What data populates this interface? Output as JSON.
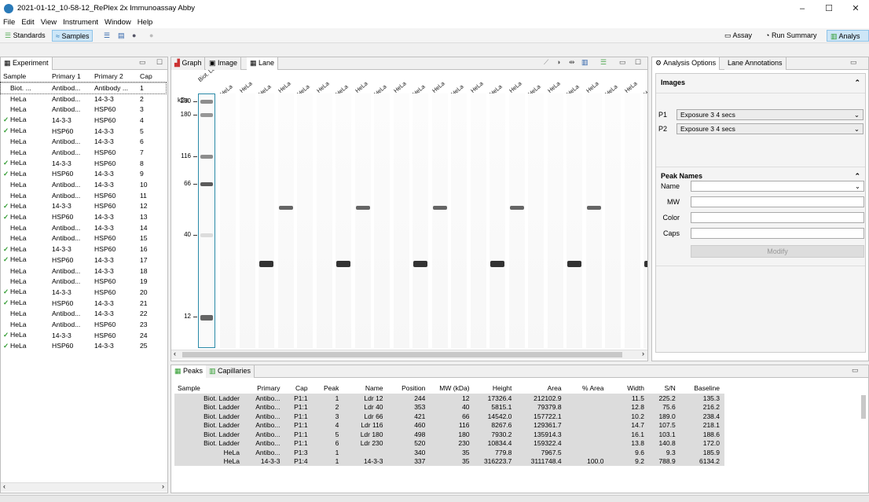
{
  "window": {
    "title": "2021-01-12_10-58-12_RePlex 2x Immunoassay Abby",
    "minimize": "–",
    "maximize": "☐",
    "close": "✕"
  },
  "menu": [
    "File",
    "Edit",
    "View",
    "Instrument",
    "Window",
    "Help"
  ],
  "toolbar": {
    "standards": "Standards",
    "samples": "Samples",
    "assay": "Assay",
    "run_summary": "Run Summary",
    "analysis": "Analys"
  },
  "experiment": {
    "tab": "Experiment",
    "headers": [
      "Sample",
      "Primary 1",
      "Primary 2",
      "Cap"
    ],
    "rows": [
      {
        "check": "",
        "sample": "Biot. ...",
        "p1": "Antibod...",
        "p2": "Antibody ...",
        "cap": "1"
      },
      {
        "check": "",
        "sample": "HeLa",
        "p1": "Antibod...",
        "p2": "14-3-3",
        "cap": "2"
      },
      {
        "check": "",
        "sample": "HeLa",
        "p1": "Antibod...",
        "p2": "HSP60",
        "cap": "3"
      },
      {
        "check": "✓",
        "sample": "HeLa",
        "p1": "14-3-3",
        "p2": "HSP60",
        "cap": "4"
      },
      {
        "check": "✓",
        "sample": "HeLa",
        "p1": "HSP60",
        "p2": "14-3-3",
        "cap": "5"
      },
      {
        "check": "",
        "sample": "HeLa",
        "p1": "Antibod...",
        "p2": "14-3-3",
        "cap": "6"
      },
      {
        "check": "",
        "sample": "HeLa",
        "p1": "Antibod...",
        "p2": "HSP60",
        "cap": "7"
      },
      {
        "check": "✓",
        "sample": "HeLa",
        "p1": "14-3-3",
        "p2": "HSP60",
        "cap": "8"
      },
      {
        "check": "✓",
        "sample": "HeLa",
        "p1": "HSP60",
        "p2": "14-3-3",
        "cap": "9"
      },
      {
        "check": "",
        "sample": "HeLa",
        "p1": "Antibod...",
        "p2": "14-3-3",
        "cap": "10"
      },
      {
        "check": "",
        "sample": "HeLa",
        "p1": "Antibod...",
        "p2": "HSP60",
        "cap": "11"
      },
      {
        "check": "✓",
        "sample": "HeLa",
        "p1": "14-3-3",
        "p2": "HSP60",
        "cap": "12"
      },
      {
        "check": "✓",
        "sample": "HeLa",
        "p1": "HSP60",
        "p2": "14-3-3",
        "cap": "13"
      },
      {
        "check": "",
        "sample": "HeLa",
        "p1": "Antibod...",
        "p2": "14-3-3",
        "cap": "14"
      },
      {
        "check": "",
        "sample": "HeLa",
        "p1": "Antibod...",
        "p2": "HSP60",
        "cap": "15"
      },
      {
        "check": "✓",
        "sample": "HeLa",
        "p1": "14-3-3",
        "p2": "HSP60",
        "cap": "16"
      },
      {
        "check": "✓",
        "sample": "HeLa",
        "p1": "HSP60",
        "p2": "14-3-3",
        "cap": "17"
      },
      {
        "check": "",
        "sample": "HeLa",
        "p1": "Antibod...",
        "p2": "14-3-3",
        "cap": "18"
      },
      {
        "check": "",
        "sample": "HeLa",
        "p1": "Antibod...",
        "p2": "HSP60",
        "cap": "19"
      },
      {
        "check": "✓",
        "sample": "HeLa",
        "p1": "14-3-3",
        "p2": "HSP60",
        "cap": "20"
      },
      {
        "check": "✓",
        "sample": "HeLa",
        "p1": "HSP60",
        "p2": "14-3-3",
        "cap": "21"
      },
      {
        "check": "",
        "sample": "HeLa",
        "p1": "Antibod...",
        "p2": "14-3-3",
        "cap": "22"
      },
      {
        "check": "",
        "sample": "HeLa",
        "p1": "Antibod...",
        "p2": "HSP60",
        "cap": "23"
      },
      {
        "check": "✓",
        "sample": "HeLa",
        "p1": "14-3-3",
        "p2": "HSP60",
        "cap": "24"
      },
      {
        "check": "✓",
        "sample": "HeLa",
        "p1": "HSP60",
        "p2": "14-3-3",
        "cap": "25"
      }
    ]
  },
  "lane_view": {
    "tabs": [
      "Graph",
      "Image",
      "Lane"
    ],
    "kda": "kDa",
    "ladder_label": "Biot. Ladder",
    "sample_label": "HeLa",
    "mw_ticks": [
      "230",
      "180",
      "116",
      "66",
      "40",
      "12"
    ]
  },
  "bottom": {
    "tabs": [
      "Peaks",
      "Capillaries"
    ],
    "headers": [
      "Sample",
      "Primary",
      "Cap",
      "Peak",
      "Name",
      "Position",
      "MW (kDa)",
      "Height",
      "Area",
      "% Area",
      "Width",
      "S/N",
      "Baseline"
    ],
    "rows": [
      [
        "Biot. Ladder",
        "Antibo...",
        "P1:1",
        "1",
        "Ldr 12",
        "244",
        "12",
        "17326.4",
        "212102.9",
        "",
        "11.5",
        "225.2",
        "135.3"
      ],
      [
        "Biot. Ladder",
        "Antibo...",
        "P1:1",
        "2",
        "Ldr 40",
        "353",
        "40",
        "5815.1",
        "79379.8",
        "",
        "12.8",
        "75.6",
        "216.2"
      ],
      [
        "Biot. Ladder",
        "Antibo...",
        "P1:1",
        "3",
        "Ldr 66",
        "421",
        "66",
        "14542.0",
        "157722.1",
        "",
        "10.2",
        "189.0",
        "238.4"
      ],
      [
        "Biot. Ladder",
        "Antibo...",
        "P1:1",
        "4",
        "Ldr 116",
        "460",
        "116",
        "8267.6",
        "129361.7",
        "",
        "14.7",
        "107.5",
        "218.1"
      ],
      [
        "Biot. Ladder",
        "Antibo...",
        "P1:1",
        "5",
        "Ldr 180",
        "498",
        "180",
        "7930.2",
        "135914.3",
        "",
        "16.1",
        "103.1",
        "188.6"
      ],
      [
        "Biot. Ladder",
        "Antibo...",
        "P1:1",
        "6",
        "Ldr 230",
        "520",
        "230",
        "10834.4",
        "159322.4",
        "",
        "13.8",
        "140.8",
        "172.0"
      ],
      [
        "HeLa",
        "Antibo...",
        "P1:3",
        "1",
        "",
        "340",
        "35",
        "779.8",
        "7967.5",
        "",
        "9.6",
        "9.3",
        "185.9"
      ],
      [
        "HeLa",
        "14-3-3",
        "P1:4",
        "1",
        "14-3-3",
        "337",
        "35",
        "316223.7",
        "3111748.4",
        "100.0",
        "9.2",
        "788.9",
        "6134.2"
      ]
    ]
  },
  "analysis": {
    "tabs": [
      "Analysis Options",
      "Lane Annotations"
    ],
    "images_title": "Images",
    "p1_label": "P1",
    "p1_value": "Exposure 3  4 secs",
    "p2_label": "P2",
    "p2_value": "Exposure 3  4 secs",
    "peak_names_title": "Peak Names",
    "name_label": "Name",
    "mw_label": "MW",
    "color_label": "Color",
    "caps_label": "Caps",
    "modify": "Modify"
  }
}
